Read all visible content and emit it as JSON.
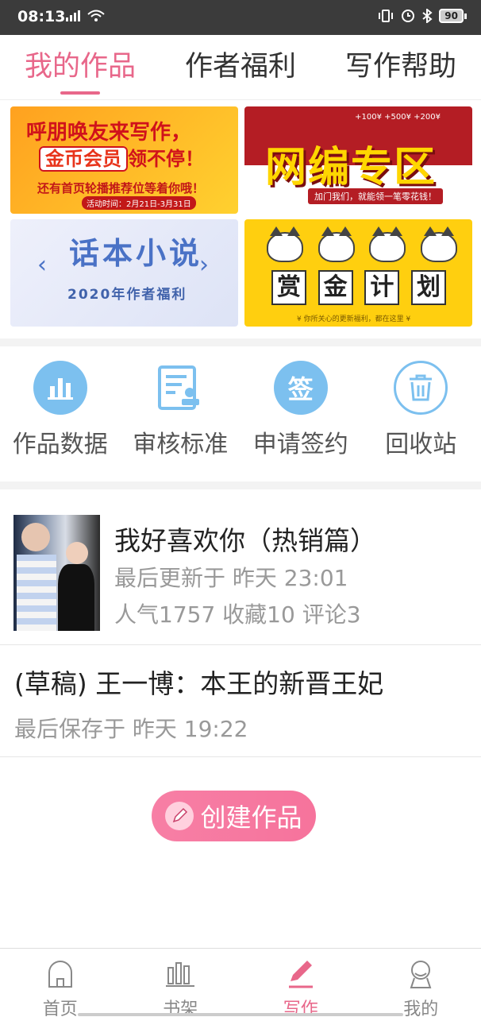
{
  "status_bar": {
    "time": "08:13",
    "network": "4G",
    "battery": "90"
  },
  "tabs": [
    {
      "label": "我的作品",
      "active": true
    },
    {
      "label": "作者福利",
      "active": false
    },
    {
      "label": "写作帮助",
      "active": false
    }
  ],
  "banners": {
    "b1": {
      "line1": "呼朋唤友来写作，",
      "line2_highlight": "金币会员",
      "line2_rest": "领不停！",
      "line3": "还有首页轮播推荐位等着你哦！",
      "line4": "活动时间：2月21日-3月31日"
    },
    "b2": {
      "title": "网编专区",
      "subtitle": "加门我们，就能领一笔零花钱！",
      "coins": "+100¥ +500¥ +200¥"
    },
    "b3": {
      "title": "话本小说",
      "subtitle": "2020年作者福利"
    },
    "b4": {
      "chars": [
        "赏",
        "金",
        "计",
        "划"
      ],
      "footer": "¥ 你所关心的更新福利，都在这里 ¥"
    }
  },
  "quick_actions": [
    {
      "label": "作品数据",
      "icon": "bar-chart-icon"
    },
    {
      "label": "审核标准",
      "icon": "review-doc-icon"
    },
    {
      "label": "申请签约",
      "icon": "sign-icon",
      "glyph": "签"
    },
    {
      "label": "回收站",
      "icon": "trash-icon"
    }
  ],
  "works": [
    {
      "title": "我好喜欢你（热销篇）",
      "updated": "最后更新于 昨天 23:01",
      "stats": "人气1757 收藏10 评论3"
    },
    {
      "title": "(草稿) 王一博：本王的新晋王妃",
      "saved": "最后保存于 昨天 19:22"
    }
  ],
  "create_button": {
    "label": "创建作品"
  },
  "bottom_nav": [
    {
      "label": "首页",
      "icon": "home-icon",
      "active": false
    },
    {
      "label": "书架",
      "icon": "bookshelf-icon",
      "active": false
    },
    {
      "label": "写作",
      "icon": "pencil-icon",
      "active": true
    },
    {
      "label": "我的",
      "icon": "profile-icon",
      "active": false
    }
  ],
  "colors": {
    "accent": "#e8678a",
    "icon_blue": "#7cc0ef",
    "create_btn": "#f6739c"
  }
}
